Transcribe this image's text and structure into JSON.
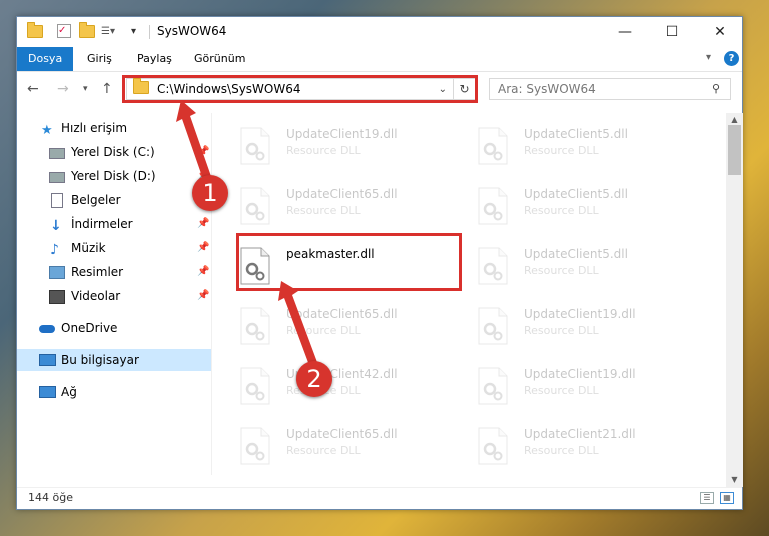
{
  "window": {
    "title": "SysWOW64",
    "controls": {
      "minimize": "—",
      "maximize": "☐",
      "close": "✕"
    }
  },
  "ribbon": {
    "tabs": [
      "Dosya",
      "Giriş",
      "Paylaş",
      "Görünüm"
    ]
  },
  "address": {
    "path": "C:\\Windows\\SysWOW64",
    "search_placeholder": "Ara: SysWOW64"
  },
  "sidebar": {
    "items": [
      {
        "label": "Hızlı erişim",
        "icon": "star-icon",
        "pinned": false
      },
      {
        "label": "Yerel Disk (C:)",
        "icon": "drive-icon",
        "pinned": true
      },
      {
        "label": "Yerel Disk (D:)",
        "icon": "drive-icon",
        "pinned": true
      },
      {
        "label": "Belgeler",
        "icon": "document-icon",
        "pinned": true
      },
      {
        "label": "İndirmeler",
        "icon": "download-icon",
        "pinned": true
      },
      {
        "label": "Müzik",
        "icon": "music-icon",
        "pinned": true
      },
      {
        "label": "Resimler",
        "icon": "pictures-icon",
        "pinned": true
      },
      {
        "label": "Videolar",
        "icon": "video-icon",
        "pinned": true
      },
      {
        "label": "OneDrive",
        "icon": "cloud-icon",
        "pinned": false
      },
      {
        "label": "Bu bilgisayar",
        "icon": "computer-icon",
        "pinned": false,
        "selected": true
      },
      {
        "label": "Ağ",
        "icon": "network-icon",
        "pinned": false
      }
    ]
  },
  "files": [
    {
      "name": "UpdateClient19.dll",
      "type": "Resource DLL"
    },
    {
      "name": "UpdateClient5.dll",
      "type": "Resource DLL"
    },
    {
      "name": "UpdateClient65.dll",
      "type": "Resource DLL"
    },
    {
      "name": "UpdateClient5.dll",
      "type": "Resource DLL"
    },
    {
      "name": "peakmaster.dll",
      "type": ""
    },
    {
      "name": "UpdateClient5.dll",
      "type": "Resource DLL"
    },
    {
      "name": "UpdateClient65.dll",
      "type": "Resource DLL"
    },
    {
      "name": "UpdateClient19.dll",
      "type": "Resource DLL"
    },
    {
      "name": "UpdateClient42.dll",
      "type": "Resource DLL"
    },
    {
      "name": "UpdateClient19.dll",
      "type": "Resource DLL"
    },
    {
      "name": "UpdateClient65.dll",
      "type": "Resource DLL"
    },
    {
      "name": "UpdateClient21.dll",
      "type": "Resource DLL"
    }
  ],
  "status": {
    "count": "144 öğe"
  },
  "annotations": {
    "step1": "1",
    "step2": "2"
  },
  "colors": {
    "accent": "#1979ca",
    "highlight": "#d9302c",
    "selected": "#cce8ff"
  }
}
